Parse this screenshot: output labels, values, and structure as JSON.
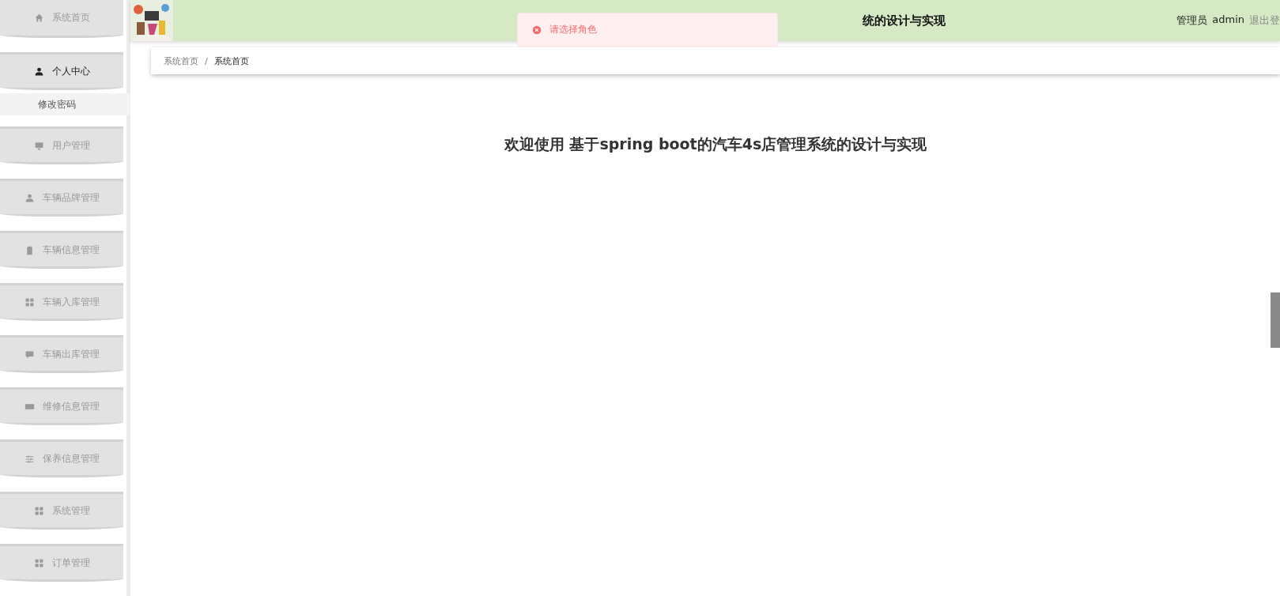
{
  "sidebar": {
    "items": [
      {
        "label": "系统首页",
        "selected": false
      },
      {
        "label": "个人中心",
        "selected": true,
        "expanded": true,
        "children": [
          {
            "label": "修改密码"
          }
        ]
      },
      {
        "label": "用户管理",
        "selected": false
      },
      {
        "label": "车辆品牌管理",
        "selected": false
      },
      {
        "label": "车辆信息管理",
        "selected": false
      },
      {
        "label": "车辆入库管理",
        "selected": false
      },
      {
        "label": "车辆出库管理",
        "selected": false
      },
      {
        "label": "维修信息管理",
        "selected": false
      },
      {
        "label": "保养信息管理",
        "selected": false
      },
      {
        "label": "系统管理",
        "selected": false
      },
      {
        "label": "订单管理",
        "selected": false
      }
    ]
  },
  "header": {
    "title": "统的设计与实现",
    "role": "管理员",
    "user": "admin",
    "logout": "退出登"
  },
  "toast": {
    "kind": "error",
    "message": "请选择角色"
  },
  "breadcrumb": [
    {
      "label": "系统首页",
      "selected": false
    },
    {
      "label": "/",
      "selected": false
    },
    {
      "label": "系统首页",
      "selected": true
    }
  ],
  "welcome": "欢迎使用 基于spring boot的汽车4s店管理系统的设计与实现"
}
